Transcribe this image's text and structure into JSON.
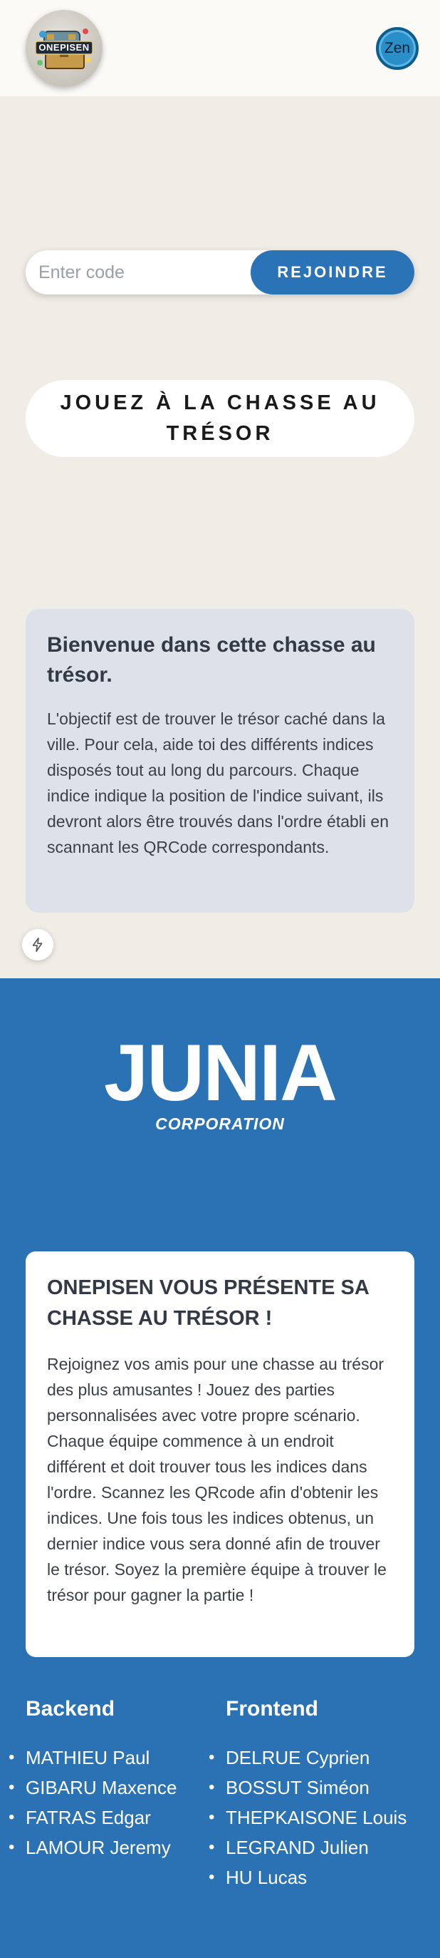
{
  "header": {
    "logo_text": "ONEPISEN",
    "zen_label": "Zen"
  },
  "join": {
    "placeholder": "Enter code",
    "button_label": "REJOINDRE"
  },
  "play": {
    "label": "JOUEZ À LA CHASSE AU TRÉSOR"
  },
  "welcome": {
    "title": "Bienvenue dans cette chasse au trésor.",
    "body": "L'objectif est de trouver le trésor caché dans la ville. Pour cela, aide toi des différents indices disposés tout au long du parcours. Chaque indice indique la position de l'indice suivant, ils devront alors être trouvés dans l'ordre établi en scannant les QRCode correspondants."
  },
  "brand": {
    "name": "JUNIA",
    "subtitle": "CORPORATION"
  },
  "promo": {
    "title": "ONEPISEN VOUS PRÉSENTE SA CHASSE AU TRÉSOR !",
    "body": "Rejoignez vos amis pour une chasse au trésor des plus amusantes ! Jouez des parties personnalisées avec votre propre scénario. Chaque équipe commence à un endroit différent et doit trouver tous les indices dans l'ordre. Scannez les QRcode afin d'obtenir les indices. Une fois tous les indices obtenus, un dernier indice vous sera donné afin de trouver le trésor. Soyez la première équipe à trouver le trésor pour gagner la partie !"
  },
  "teams": {
    "backend": {
      "title": "Backend",
      "members": [
        "MATHIEU Paul",
        "GIBARU Maxence",
        "FATRAS Edgar",
        "LAMOUR Jeremy"
      ]
    },
    "frontend": {
      "title": "Frontend",
      "members": [
        "DELRUE Cyprien",
        "BOSSUT Siméon",
        "THEPKAISONE Louis",
        "LEGRAND Julien",
        "HU Lucas"
      ]
    }
  },
  "colors": {
    "page_bg": "#f0ede6",
    "primary_blue": "#2b72b5",
    "button_blue": "#2a73b7",
    "welcome_card_bg": "#dce1ea"
  },
  "icons": {
    "zen": "zen-circle-icon",
    "bolt": "lightning-bolt-icon"
  }
}
